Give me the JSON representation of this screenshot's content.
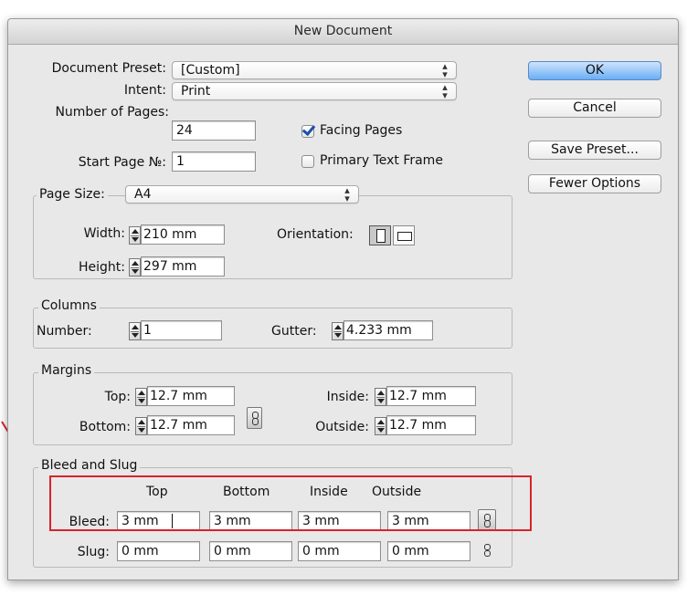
{
  "window": {
    "title": "New Document"
  },
  "document_preset": {
    "label": "Document Preset:",
    "value": "[Custom]"
  },
  "intent": {
    "label": "Intent:",
    "value": "Print"
  },
  "pages": {
    "number_label": "Number of Pages:",
    "number_value": "24",
    "start_label": "Start Page №:",
    "start_value": "1",
    "facing_label": "Facing Pages",
    "facing_checked": true,
    "primary_label": "Primary Text Frame",
    "primary_checked": false
  },
  "page_size": {
    "label": "Page Size:",
    "value": "A4",
    "width_label": "Width:",
    "width_value": "210 mm",
    "height_label": "Height:",
    "height_value": "297 mm",
    "orientation_label": "Orientation:",
    "orientation_selected": "portrait"
  },
  "columns": {
    "legend": "Columns",
    "number_label": "Number:",
    "number_value": "1",
    "gutter_label": "Gutter:",
    "gutter_value": "4.233 mm"
  },
  "margins": {
    "legend": "Margins",
    "top_label": "Top:",
    "top_value": "12.7 mm",
    "bottom_label": "Bottom:",
    "bottom_value": "12.7 mm",
    "inside_label": "Inside:",
    "inside_value": "12.7 mm",
    "outside_label": "Outside:",
    "outside_value": "12.7 mm"
  },
  "bleed_slug": {
    "legend": "Bleed and Slug",
    "headers": [
      "Top",
      "Bottom",
      "Inside",
      "Outside"
    ],
    "bleed_label": "Bleed:",
    "bleed_values": [
      "3 mm",
      "3 mm",
      "3 mm",
      "3 mm"
    ],
    "slug_label": "Slug:",
    "slug_values": [
      "0 mm",
      "0 mm",
      "0 mm",
      "0 mm"
    ]
  },
  "buttons": {
    "ok": "OK",
    "cancel": "Cancel",
    "save_preset": "Save Preset...",
    "fewer_options": "Fewer Options"
  },
  "annotation": {
    "highlight_color": "#d8232a",
    "arrow_color": "#d8232a"
  },
  "icons": [
    "stepper-icon",
    "chain-link-icon",
    "portrait-orientation-icon",
    "landscape-orientation-icon",
    "popup-arrows-icon",
    "checkmark-icon"
  ]
}
